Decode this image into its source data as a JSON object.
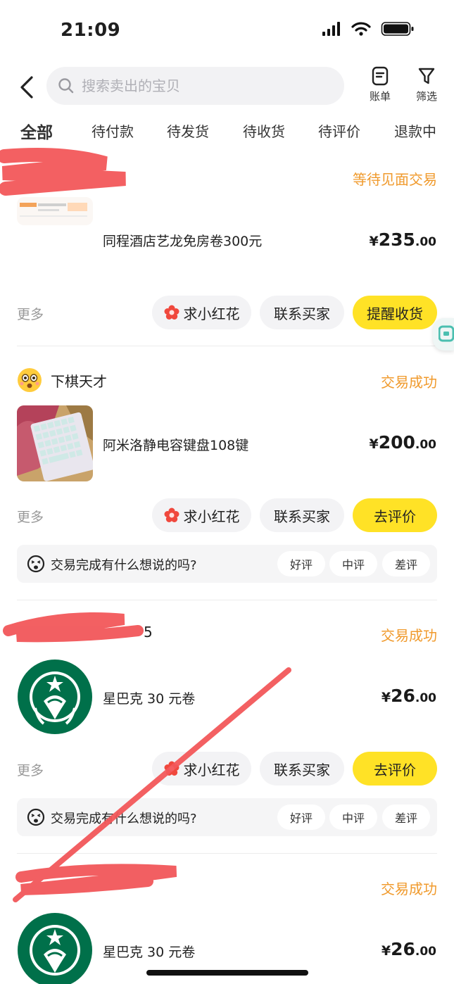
{
  "status_bar": {
    "time": "21:09"
  },
  "header": {
    "search_placeholder": "搜索卖出的宝贝",
    "bill_label": "账单",
    "filter_label": "筛选"
  },
  "tabs": [
    "全部",
    "待付款",
    "待发货",
    "待收货",
    "待评价",
    "退款中"
  ],
  "orders": [
    {
      "seller": "",
      "status": "等待见面交易",
      "title": "同程酒店艺龙免房卷300元",
      "price_currency": "¥",
      "price_int": "235",
      "price_dec": ".00",
      "more": "更多",
      "buttons": [
        "求小红花",
        "联系买家",
        "提醒收货"
      ]
    },
    {
      "seller": "下棋天才",
      "status": "交易成功",
      "title": "阿米洛静电容键盘108键",
      "price_currency": "¥",
      "price_int": "200",
      "price_dec": ".00",
      "more": "更多",
      "buttons": [
        "求小红花",
        "联系买家",
        "去评价"
      ],
      "review": {
        "question": "交易完成有什么想说的吗?",
        "options": [
          "好评",
          "中评",
          "差评"
        ]
      }
    },
    {
      "seller": "5",
      "status": "交易成功",
      "title": "星巴克 30 元卷",
      "price_currency": "¥",
      "price_int": "26",
      "price_dec": ".00",
      "more": "更多",
      "buttons": [
        "求小红花",
        "联系买家",
        "去评价"
      ],
      "review": {
        "question": "交易完成有什么想说的吗?",
        "options": [
          "好评",
          "中评",
          "差评"
        ]
      }
    },
    {
      "seller": "",
      "status": "交易成功",
      "title": "星巴克 30 元卷",
      "price_currency": "¥",
      "price_int": "26",
      "price_dec": ".00"
    }
  ],
  "colors": {
    "accent_yellow": "#ffe226",
    "status_orange": "#f09a2c",
    "starbucks_green": "#00704a"
  }
}
